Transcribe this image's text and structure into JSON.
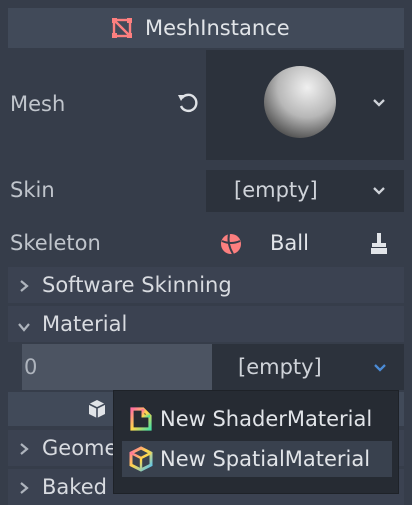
{
  "header": {
    "title": "MeshInstance",
    "icon": "mesh-instance-icon"
  },
  "mesh": {
    "label": "Mesh"
  },
  "skin": {
    "label": "Skin",
    "value": "[empty]"
  },
  "skeleton": {
    "label": "Skeleton",
    "value": "Ball"
  },
  "sections": {
    "software_skinning": "Software Skinning",
    "material": "Material"
  },
  "material_row": {
    "index": "0",
    "value": "[empty]"
  },
  "hidden_sections": {
    "geometry": "Geome",
    "baked": "Baked"
  },
  "menu": {
    "items": [
      {
        "label": "New ShaderMaterial",
        "icon": "shader-material-icon"
      },
      {
        "label": "New SpatialMaterial",
        "icon": "spatial-material-icon"
      }
    ]
  },
  "colors": {
    "background": "#363d4a",
    "header": "#414a59",
    "field": "#2c323c",
    "accent_blue": "#4b8bd6",
    "node_red": "#fc7f7f",
    "yellow": "#ffd24a"
  }
}
